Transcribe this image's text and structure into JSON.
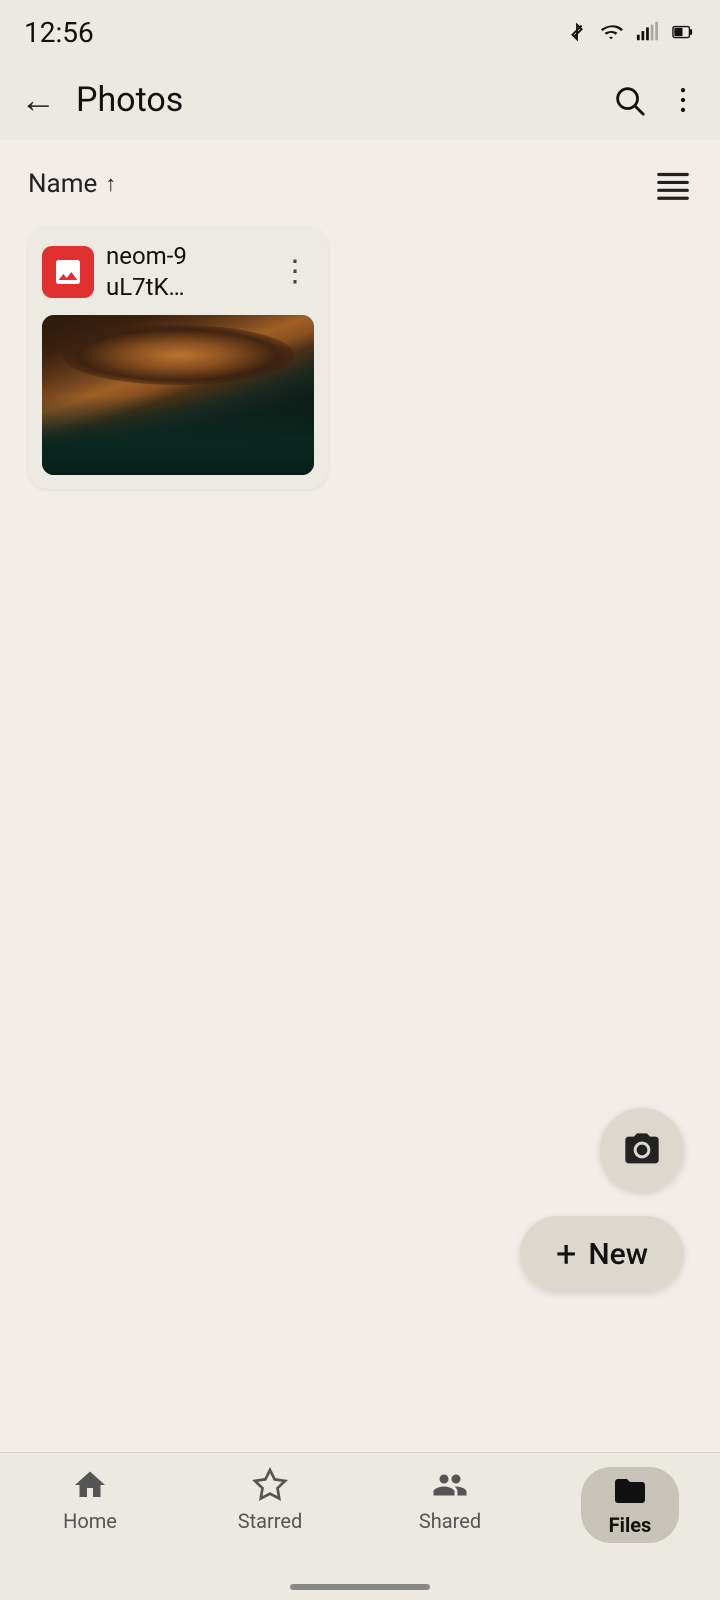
{
  "status": {
    "time": "12:56"
  },
  "appBar": {
    "title": "Photos",
    "backLabel": "←",
    "searchLabel": "🔍",
    "moreLabel": "⋮"
  },
  "sort": {
    "label": "Name",
    "arrow": "↑",
    "listViewLabel": "≡"
  },
  "files": [
    {
      "name": "neom-9\nuL7tK…",
      "type": "image"
    }
  ],
  "fab": {
    "camera": "📷",
    "newLabel": "New",
    "newPlus": "+"
  },
  "bottomNav": {
    "items": [
      {
        "id": "home",
        "label": "Home",
        "icon": "home",
        "active": false
      },
      {
        "id": "starred",
        "label": "Starred",
        "icon": "star",
        "active": false
      },
      {
        "id": "shared",
        "label": "Shared",
        "icon": "people",
        "active": false
      },
      {
        "id": "files",
        "label": "Files",
        "icon": "folder",
        "active": true
      }
    ]
  }
}
